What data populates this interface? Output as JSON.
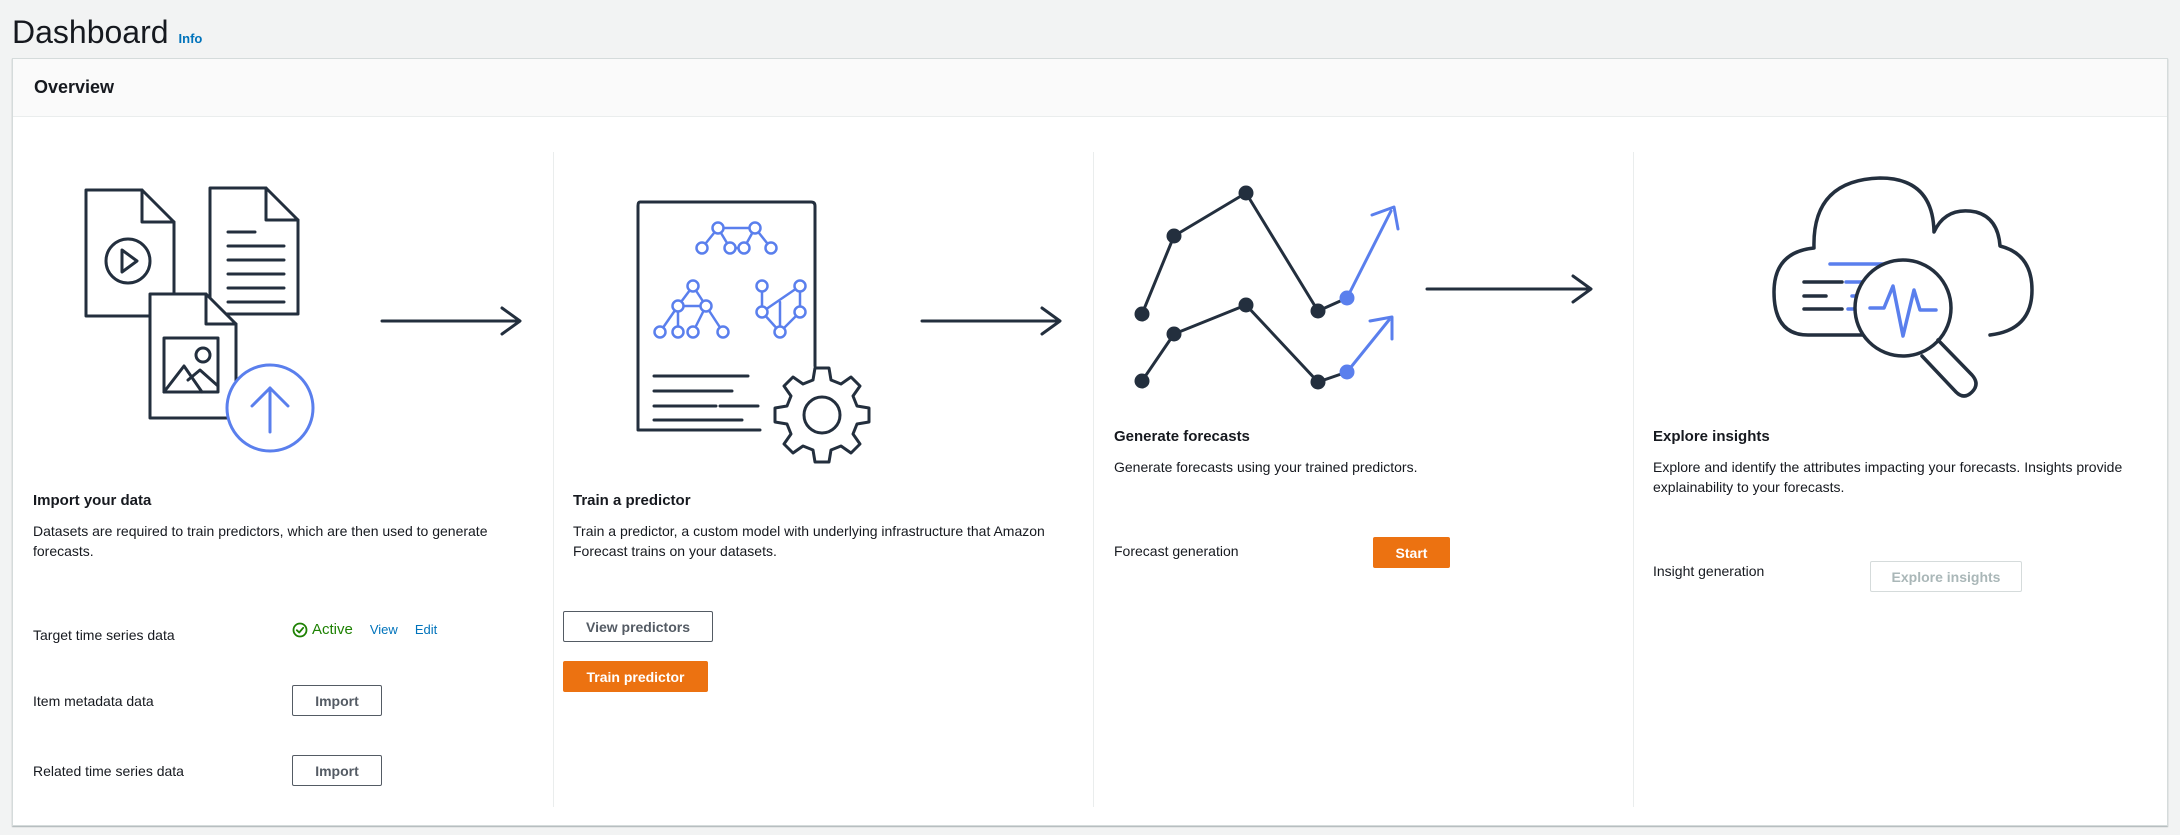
{
  "header": {
    "title": "Dashboard",
    "info_label": "Info"
  },
  "overview": {
    "title": "Overview",
    "import": {
      "title": "Import your data",
      "description": "Datasets are required to train predictors, which are then used to generate forecasts.",
      "rows": [
        {
          "label": "Target time series data",
          "status": "Active",
          "view_label": "View",
          "edit_label": "Edit"
        },
        {
          "label": "Item metadata data",
          "button": "Import"
        },
        {
          "label": "Related time series data",
          "button": "Import"
        }
      ]
    },
    "train": {
      "title": "Train a predictor",
      "description": "Train a predictor, a custom model with underlying infrastructure that Amazon Forecast trains on your datasets.",
      "view_button": "View predictors",
      "train_button": "Train predictor"
    },
    "generate": {
      "title": "Generate forecasts",
      "description": "Generate forecasts using your trained predictors.",
      "row_label": "Forecast generation",
      "start_button": "Start"
    },
    "explore": {
      "title": "Explore insights",
      "description": "Explore and identify the attributes impacting your forecasts. Insights provide explainability to your forecasts.",
      "row_label": "Insight generation",
      "button": "Explore insights"
    }
  },
  "colors": {
    "accent": "#ec7211",
    "link": "#0073bb",
    "success": "#1d8102",
    "illustration": "#232f3e",
    "illustration_accent": "#5a7fed"
  },
  "icons": [
    "files-upload-illustration",
    "predictor-gear-illustration",
    "forecast-chart-illustration",
    "cloud-insights-illustration",
    "arrow-right-icon",
    "check-circle-icon"
  ]
}
